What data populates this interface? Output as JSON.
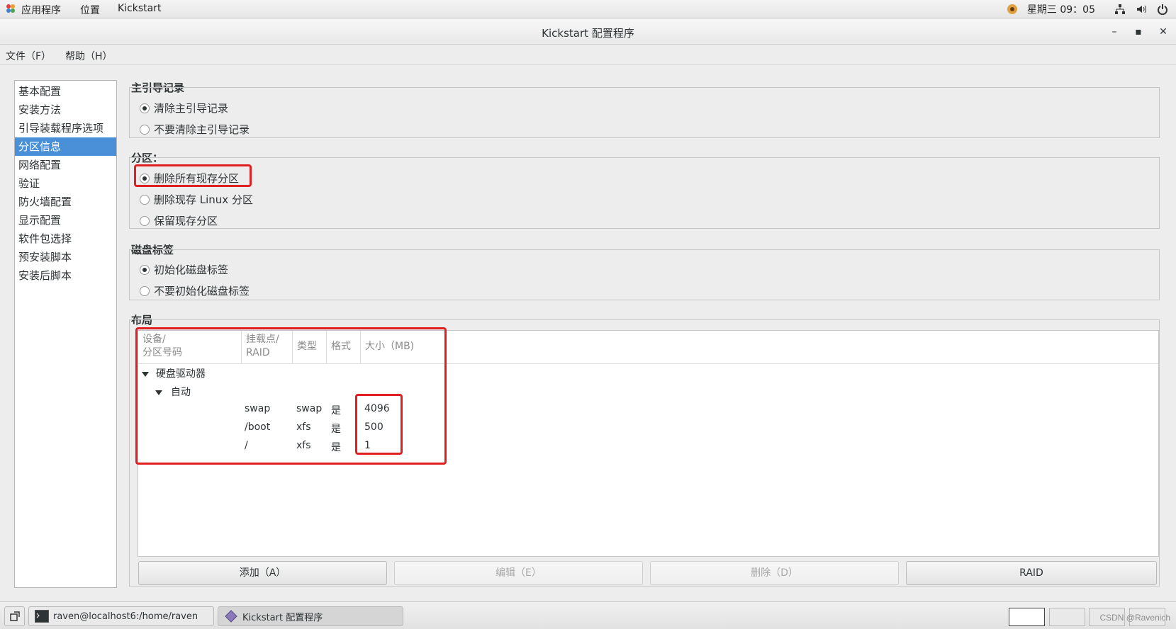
{
  "top_panel": {
    "applications": "应用程序",
    "places": "位置",
    "active_app": "Kickstart",
    "clock": "星期三 09：05"
  },
  "window": {
    "title": "Kickstart 配置程序",
    "minimize": "–",
    "maximize": "▪",
    "close": "✕"
  },
  "menubar": {
    "file": "文件（F）",
    "help": "帮助（H）"
  },
  "sidebar": {
    "items": [
      {
        "label": "基本配置"
      },
      {
        "label": "安装方法"
      },
      {
        "label": "引导装载程序选项"
      },
      {
        "label": "分区信息",
        "selected": true
      },
      {
        "label": "网络配置"
      },
      {
        "label": "验证"
      },
      {
        "label": "防火墙配置"
      },
      {
        "label": "显示配置"
      },
      {
        "label": "软件包选择"
      },
      {
        "label": "预安装脚本"
      },
      {
        "label": "安装后脚本"
      }
    ]
  },
  "mbr": {
    "label": "主引导记录",
    "options": [
      {
        "label": "清除主引导记录",
        "checked": true
      },
      {
        "label": "不要清除主引导记录",
        "checked": false
      }
    ]
  },
  "partitions": {
    "label": "分区：",
    "options": [
      {
        "label": "删除所有现存分区",
        "checked": true
      },
      {
        "label": "删除现存  Linux 分区",
        "checked": false
      },
      {
        "label": "保留现存分区",
        "checked": false
      }
    ]
  },
  "disklabel": {
    "label": "磁盘标签",
    "options": [
      {
        "label": "初始化磁盘标签",
        "checked": true
      },
      {
        "label": "不要初始化磁盘标签",
        "checked": false
      }
    ]
  },
  "layout": {
    "label": "布局",
    "columns": [
      "设备/\n分区号码",
      "挂载点/\nRAID",
      "类型",
      "格式",
      "大小（MB)"
    ],
    "tree": {
      "root": "硬盘驱动器",
      "child": "自动",
      "rows": [
        {
          "mount": "swap",
          "type": "swap",
          "format": "是",
          "size": "4096"
        },
        {
          "mount": "/boot",
          "type": "xfs",
          "format": "是",
          "size": "500"
        },
        {
          "mount": "/",
          "type": "xfs",
          "format": "是",
          "size": "1"
        }
      ]
    },
    "buttons": {
      "add": "添加（A）",
      "edit": "编辑（E）",
      "delete": "删除（D）",
      "raid": "RAID"
    }
  },
  "taskbar": {
    "terminal": "raven@localhost6:/home/raven",
    "kickstart": "Kickstart 配置程序",
    "watermark": "CSDN @Ravenich"
  },
  "colors": {
    "selection": "#4a90d9",
    "annotation": "#e02020"
  }
}
